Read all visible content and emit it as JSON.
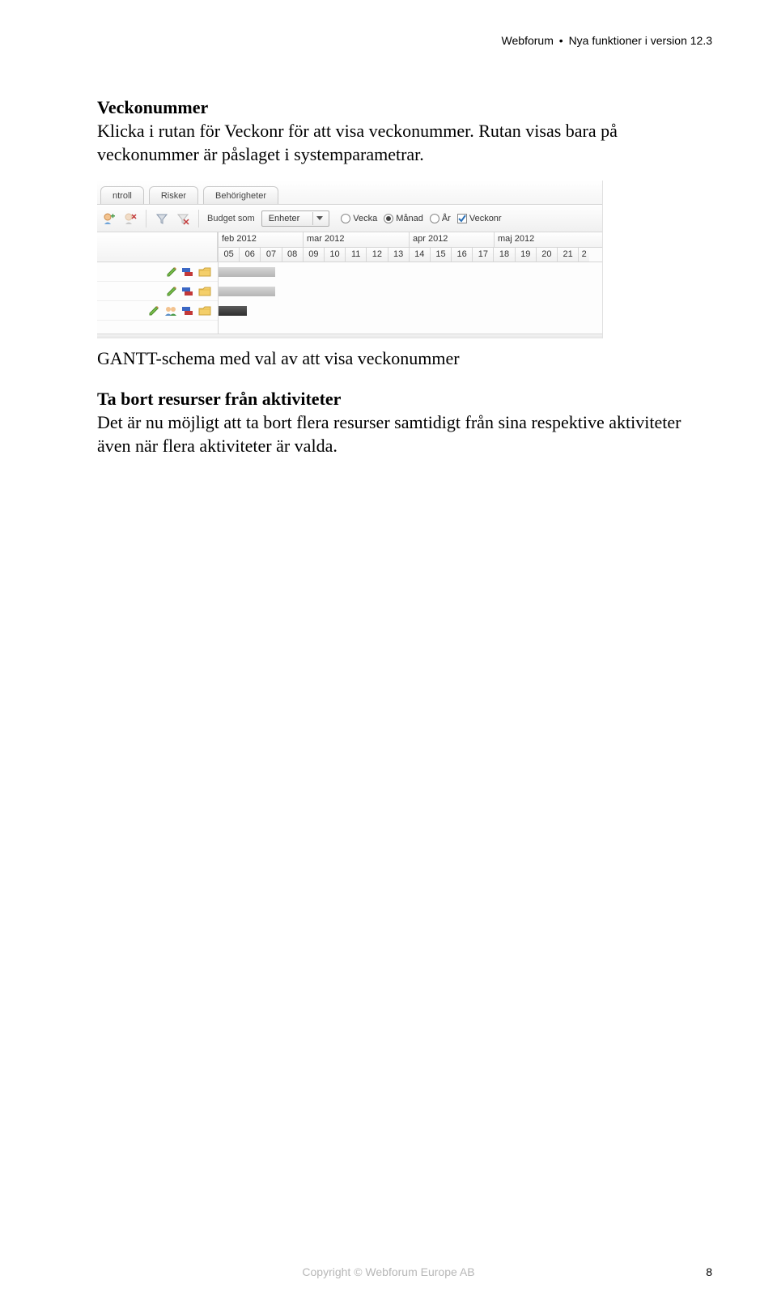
{
  "header": {
    "brand": "Webforum",
    "bullet": "•",
    "doc_title": "Nya funktioner i version 12.3"
  },
  "section1": {
    "heading": "Veckonummer",
    "body": "Klicka i rutan för Veckonr för att visa veckonummer. Rutan visas bara på veckonummer är påslaget i systemparametrar."
  },
  "shot": {
    "tabs": [
      "ntroll",
      "Risker",
      "Behörigheter"
    ],
    "budget_label": "Budget som",
    "dropdown_value": "Enheter",
    "radios": {
      "vecka": "Vecka",
      "manad": "Månad",
      "ar": "År",
      "veckonr": "Veckonr"
    },
    "months": [
      "feb 2012",
      "mar 2012",
      "apr 2012",
      "maj 2012"
    ],
    "weeks": [
      "05",
      "06",
      "07",
      "08",
      "09",
      "10",
      "11",
      "12",
      "13",
      "14",
      "15",
      "16",
      "17",
      "18",
      "19",
      "20",
      "21",
      "2"
    ]
  },
  "caption": "GANTT-schema med val av att visa veckonummer",
  "section2": {
    "heading": "Ta bort resurser från aktiviteter",
    "body": "Det är nu möjligt att ta bort flera resurser samtidigt från sina respektive aktiviteter även när flera aktiviteter är valda."
  },
  "footer": {
    "copyright": "Copyright © Webforum Europe AB",
    "page": "8"
  }
}
